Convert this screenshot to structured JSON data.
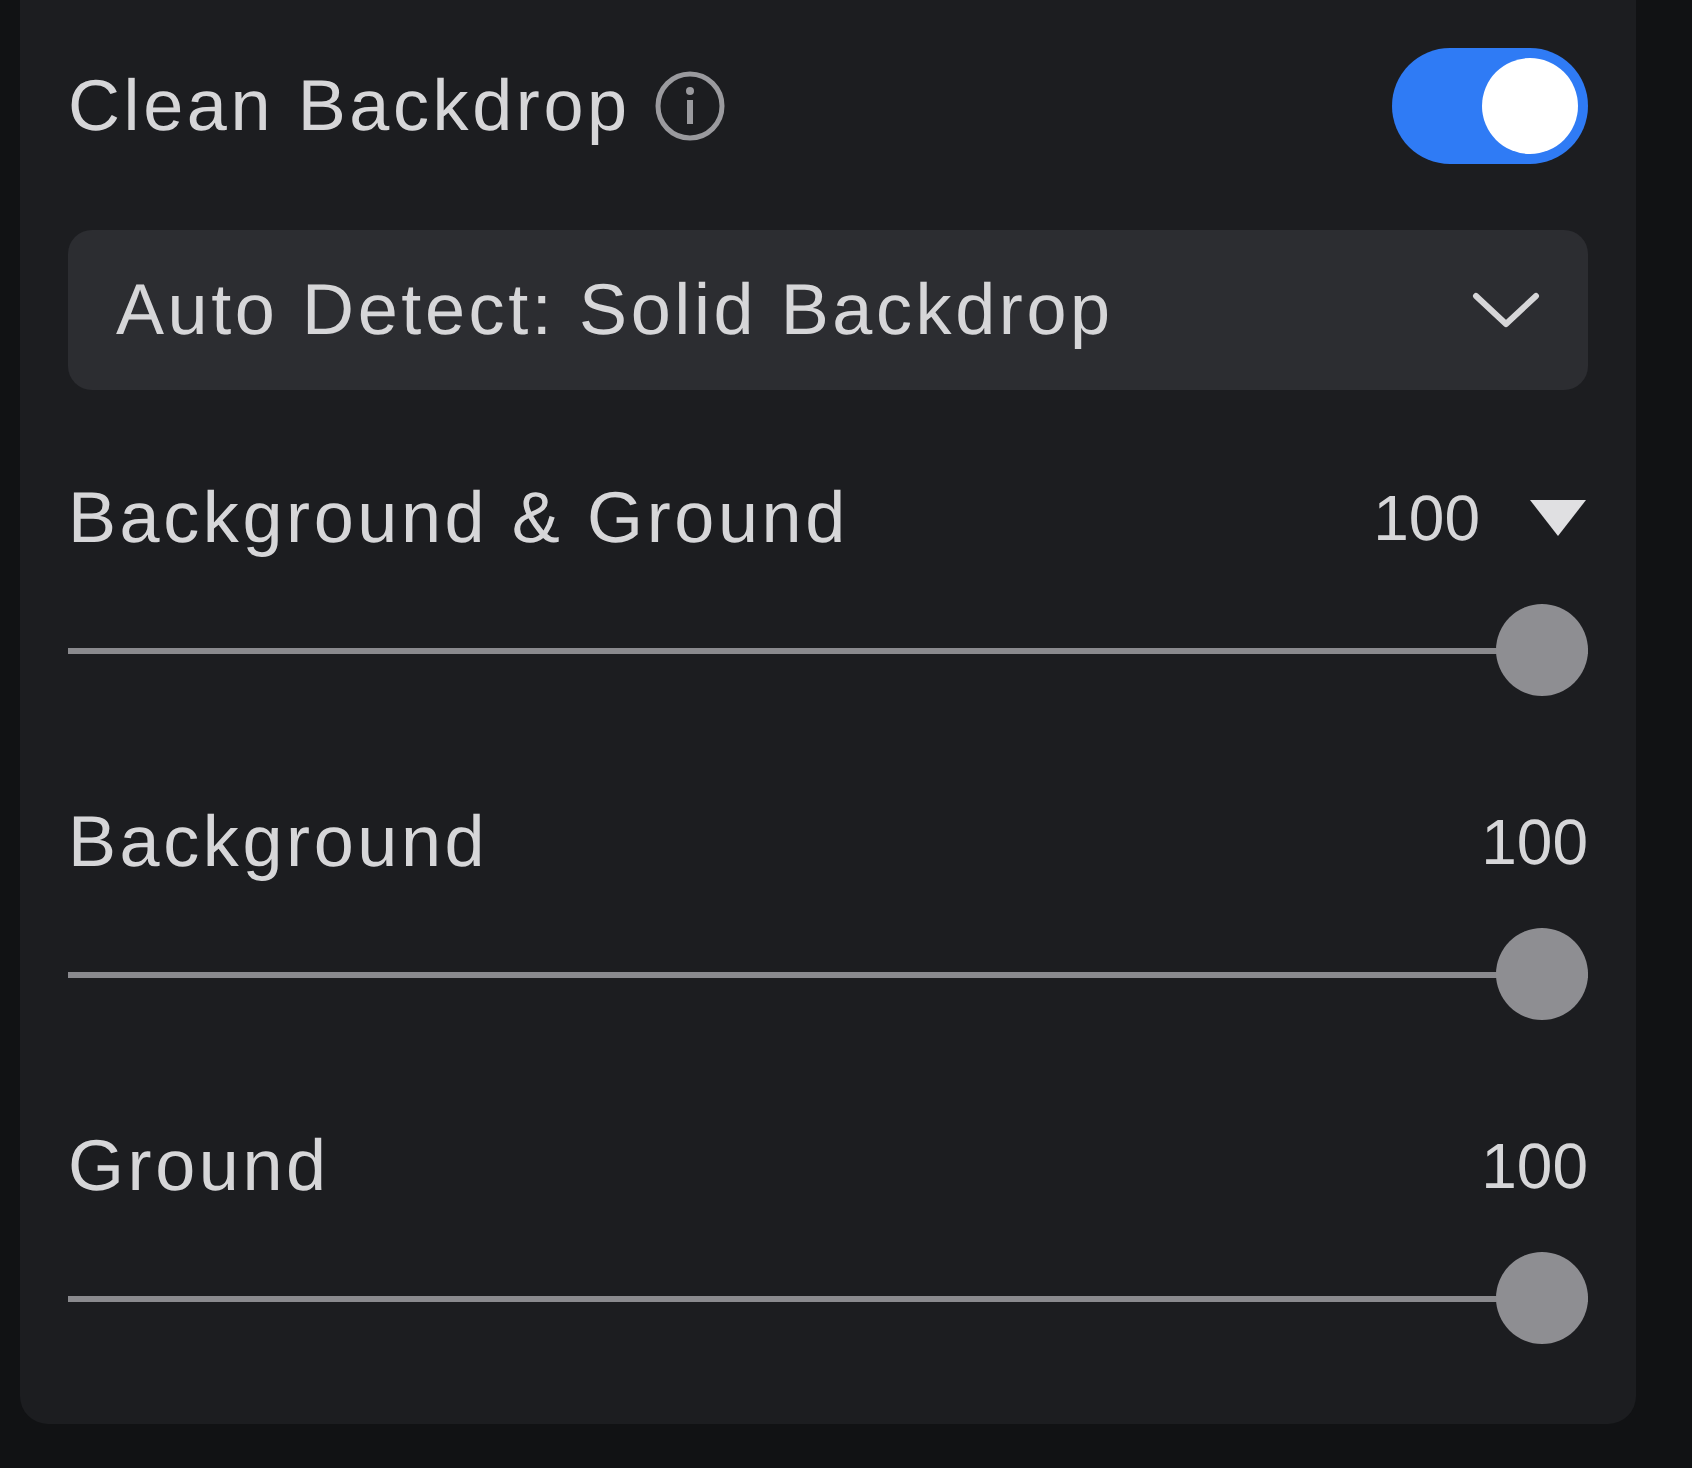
{
  "toggle": {
    "label": "Clean Backdrop",
    "on": true
  },
  "dropdown": {
    "value": "Auto Detect: Solid Backdrop"
  },
  "sliders": [
    {
      "label": "Background & Ground",
      "value": "100",
      "expandable": true,
      "level": 1
    },
    {
      "label": "Background",
      "value": "100",
      "expandable": false,
      "level": 1
    },
    {
      "label": "Ground",
      "value": "100",
      "expandable": false,
      "level": 1
    }
  ]
}
